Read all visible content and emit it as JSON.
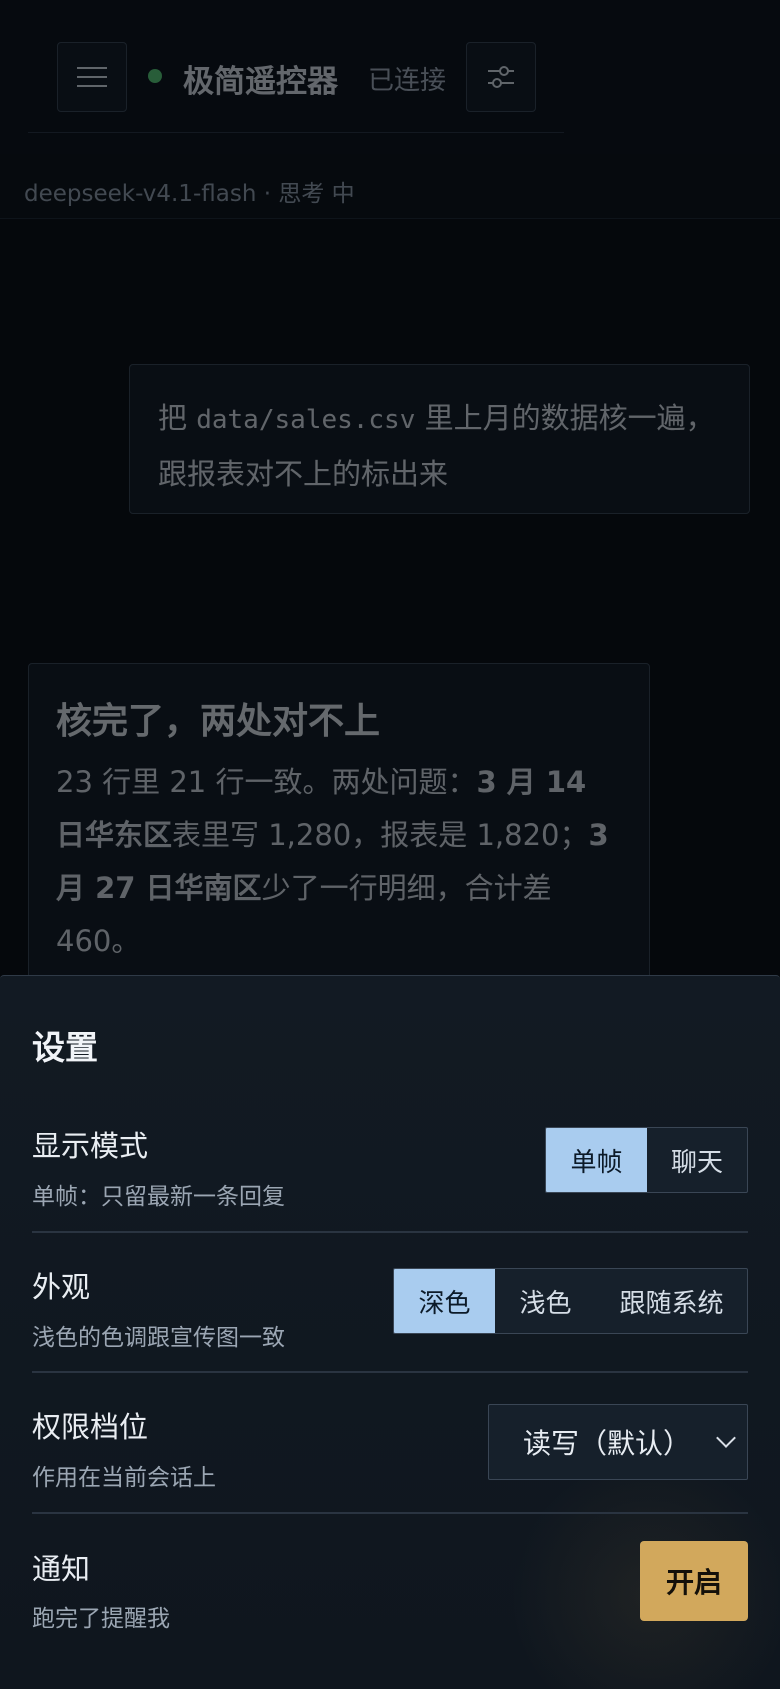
{
  "header": {
    "title": "极简遥控器",
    "status": "已连接",
    "model_line": "deepseek-v4.1-flash · 思考 中"
  },
  "conversation": {
    "user_message": {
      "part1": "把 ",
      "code": "data/sales.csv",
      "part2": " 里上月的数据核一遍，跟报表对不上的标出来"
    },
    "assistant_reply": {
      "title": "核完了，两处对不上",
      "t1": "23 行里 21 行一致。两处问题：",
      "b1": "3 月 14 日华东区",
      "t2": "表里写 1,280，报表是 1,820；",
      "b2": "3 月 27 日华南区",
      "t3": "少了一行明细，合计差 460。"
    }
  },
  "settings": {
    "title": "设置",
    "display_mode": {
      "label": "显示模式",
      "hint": "单帧：只留最新一条回复",
      "options": [
        "单帧",
        "聊天"
      ],
      "selected": "单帧"
    },
    "appearance": {
      "label": "外观",
      "hint": "浅色的色调跟宣传图一致",
      "options": [
        "深色",
        "浅色",
        "跟随系统"
      ],
      "selected": "深色"
    },
    "permission": {
      "label": "权限档位",
      "hint": "作用在当前会话上",
      "value": "读写（默认）"
    },
    "notify": {
      "label": "通知",
      "hint": "跑完了提醒我",
      "button": "开启"
    }
  },
  "colors": {
    "accent_selected": "#a9ccef",
    "button_gold": "#d2a85c",
    "status_green": "#5bd37a"
  }
}
